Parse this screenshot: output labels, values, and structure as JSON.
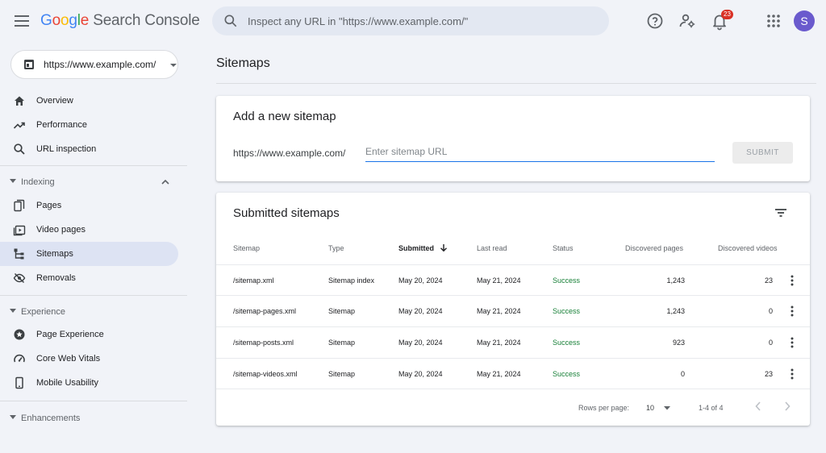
{
  "header": {
    "logo_google": [
      "G",
      "o",
      "o",
      "g",
      "l",
      "e"
    ],
    "logo_product": "Search Console",
    "search_placeholder": "Inspect any URL in \"https://www.example.com/\"",
    "notifications_count": "23",
    "avatar_initial": "S"
  },
  "sidebar": {
    "property": "https://www.example.com/",
    "top_items": [
      {
        "label": "Overview",
        "icon": "home-icon"
      },
      {
        "label": "Performance",
        "icon": "trending-up-icon"
      },
      {
        "label": "URL inspection",
        "icon": "search-icon"
      }
    ],
    "indexing": {
      "label": "Indexing",
      "items": [
        {
          "label": "Pages",
          "icon": "pages-icon"
        },
        {
          "label": "Video pages",
          "icon": "video-icon"
        },
        {
          "label": "Sitemaps",
          "icon": "sitemap-icon",
          "active": true
        },
        {
          "label": "Removals",
          "icon": "eye-off-icon"
        }
      ]
    },
    "experience": {
      "label": "Experience",
      "items": [
        {
          "label": "Page Experience",
          "icon": "star-badge-icon"
        },
        {
          "label": "Core Web Vitals",
          "icon": "gauge-icon"
        },
        {
          "label": "Mobile Usability",
          "icon": "phone-icon"
        }
      ]
    },
    "enhancements": {
      "label": "Enhancements"
    }
  },
  "main": {
    "title": "Sitemaps",
    "add_card": {
      "title": "Add a new sitemap",
      "prefix": "https://www.example.com/",
      "placeholder": "Enter sitemap URL",
      "submit_label": "SUBMIT"
    },
    "submitted_card": {
      "title": "Submitted sitemaps",
      "columns": [
        "Sitemap",
        "Type",
        "Submitted",
        "Last read",
        "Status",
        "Discovered pages",
        "Discovered videos"
      ],
      "rows": [
        {
          "sitemap": "/sitemap.xml",
          "type": "Sitemap index",
          "submitted": "May 20, 2024",
          "last_read": "May 21, 2024",
          "status": "Success",
          "pages": "1,243",
          "videos": "23"
        },
        {
          "sitemap": "/sitemap-pages.xml",
          "type": "Sitemap",
          "submitted": "May 20, 2024",
          "last_read": "May 21, 2024",
          "status": "Success",
          "pages": "1,243",
          "videos": "0"
        },
        {
          "sitemap": "/sitemap-posts.xml",
          "type": "Sitemap",
          "submitted": "May 20, 2024",
          "last_read": "May 21, 2024",
          "status": "Success",
          "pages": "923",
          "videos": "0"
        },
        {
          "sitemap": "/sitemap-videos.xml",
          "type": "Sitemap",
          "submitted": "May 20, 2024",
          "last_read": "May 21, 2024",
          "status": "Success",
          "pages": "0",
          "videos": "23"
        }
      ],
      "footer": {
        "rows_per_page_label": "Rows per page:",
        "rows_per_page_value": "10",
        "range": "1-4 of 4"
      }
    }
  },
  "colors": {
    "accent": "#1a73e8",
    "success": "#188038",
    "active_nav": "#dde3f3",
    "page_bg": "#f1f3f8",
    "badge": "#d93025",
    "avatar": "#6a5acd"
  }
}
